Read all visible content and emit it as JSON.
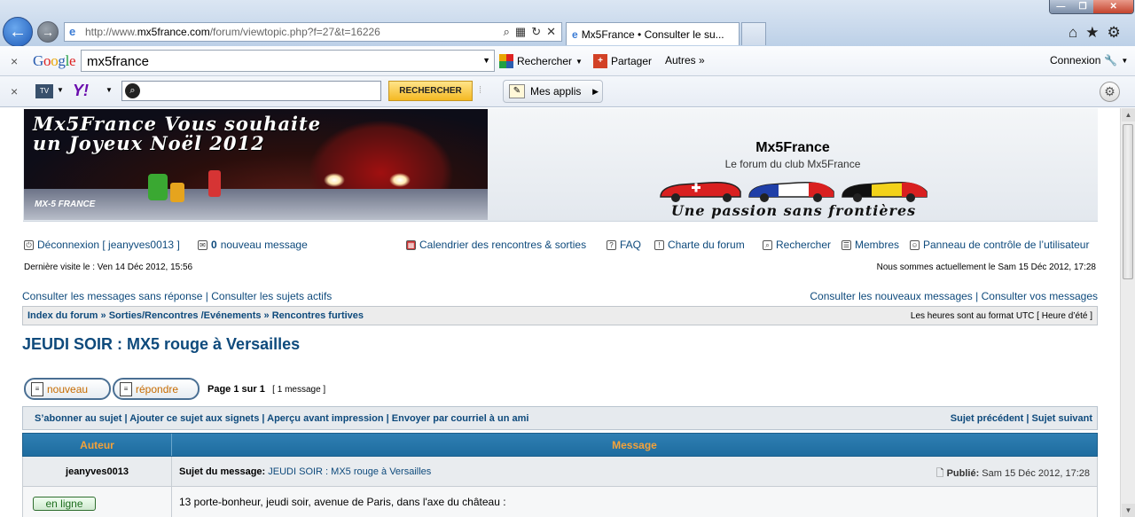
{
  "browser": {
    "url_prefix": "http://www.",
    "url_domain": "mx5france.com",
    "url_path": "/forum/viewtopic.php?f=27&t=16226",
    "tab_title": "Mx5France • Consulter le su..."
  },
  "google_toolbar": {
    "logo": "Google",
    "search_value": "mx5france",
    "search_label": "Rechercher",
    "share_label": "Partager",
    "others_label": "Autres »",
    "connect_label": "Connexion"
  },
  "yahoo_toolbar": {
    "logo": "Y!",
    "tv_label": "TV",
    "search_button": "RECHERCHER",
    "apps_label": "Mes applis"
  },
  "header": {
    "banner_line1": "Mx5France Vous souhaite",
    "banner_line2": "un Joyeux Noël 2012",
    "banner_logo": "MX-5 FRANCE",
    "site_title": "Mx5France",
    "site_desc": "Le forum du club Mx5France",
    "slogan": "Une passion sans frontières"
  },
  "nav": {
    "logout": "Déconnexion [ jeanyves0013 ]",
    "new_msg_count": "0",
    "new_msg_label": "nouveau message",
    "calendar": "Calendrier des rencontres & sorties",
    "faq": "FAQ",
    "charter": "Charte du forum",
    "search": "Rechercher",
    "members": "Membres",
    "ucp": "Panneau de contrôle de l’utilisateur"
  },
  "last_visit": "Dernière visite le : Ven 14 Déc 2012, 15:56",
  "current_time": "Nous sommes actuellement le Sam 15 Déc 2012, 17:28",
  "links": {
    "unanswered": "Consulter les messages sans réponse",
    "active": "Consulter les sujets actifs",
    "new_posts": "Consulter les nouveaux messages",
    "your_posts": "Consulter vos messages"
  },
  "breadcrumb": {
    "index": "Index du forum",
    "forum": "Sorties/Rencontres /Evénements",
    "subforum": "Rencontres furtives",
    "timezone": "Les heures sont au format UTC [ Heure d’été ]"
  },
  "topic_title": "JEUDI SOIR : MX5 rouge à Versailles",
  "buttons": {
    "new": "nouveau",
    "reply": "répondre"
  },
  "pagination": {
    "pages": "Page 1 sur 1",
    "count": "[ 1 message ]"
  },
  "actions": {
    "subscribe": "S’abonner au sujet",
    "bookmark": "Ajouter ce sujet aux signets",
    "print": "Aperçu avant impression",
    "email": "Envoyer par courriel à un ami",
    "prev": "Sujet précédent",
    "next": "Sujet suivant"
  },
  "table": {
    "author_header": "Auteur",
    "message_header": "Message"
  },
  "post": {
    "author": "jeanyves0013",
    "subject_label": "Sujet du message:",
    "subject": "JEUDI SOIR : MX5 rouge à Versailles",
    "published_label": "Publié:",
    "published": "Sam 15 Déc 2012, 17:28",
    "online": "en ligne",
    "text": "13 porte-bonheur, jeudi soir, avenue de Paris, dans l'axe du château :"
  },
  "colors": {
    "link": "#0e4a7c",
    "header_blue": "#2f7fb3",
    "header_text": "#f4a23a"
  }
}
